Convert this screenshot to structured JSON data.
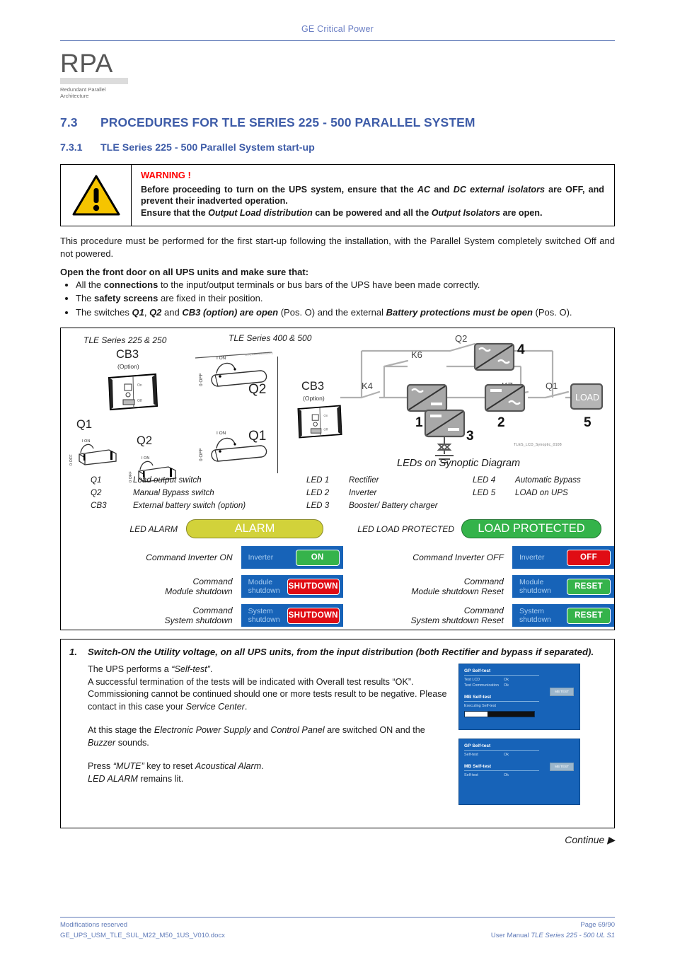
{
  "header": {
    "title": "GE Critical Power"
  },
  "logo": {
    "word": "RPA",
    "line1": "Redundant Parallel",
    "line2": "Architecture"
  },
  "headings": {
    "h1_number": "7.3",
    "h1_text": "PROCEDURES FOR TLE SERIES 225 - 500 PARALLEL SYSTEM",
    "h2_number": "7.3.1",
    "h2_text": "TLE Series 225 - 500 Parallel System start-up"
  },
  "warning": {
    "icon": "warning-triangle-icon",
    "title": "WARNING !",
    "line1_a": "Before proceeding to turn on the UPS system, ensure that the ",
    "line1_i1": "AC",
    "line1_b": " and ",
    "line1_i2": "DC external isolators",
    "line1_c": " are OFF, and prevent their inadverted operation.",
    "line2_a": "Ensure that the ",
    "line2_i1": "Output Load distribution",
    "line2_b": " can be powered and all the ",
    "line2_i2": "Output Isolators",
    "line2_c": " are open."
  },
  "intro": {
    "paragraph": "This procedure must be performed for the first start-up following the installation, with the Parallel System completely switched Off and not powered.",
    "bold_lead": "Open the front door on all UPS units and make sure that:",
    "bullets": [
      {
        "a": "All the ",
        "b1": "connections",
        "c": " to the input/output terminals or bus bars of the UPS have been made correctly."
      },
      {
        "a": "The ",
        "b1": "safety screens",
        "c": " are fixed in their position."
      },
      {
        "a": "The switches ",
        "b1": "Q1",
        "mid1": ", ",
        "b2": "Q2",
        "mid2": " and ",
        "b3": "CB3 (option) are open",
        "mid3": " (Pos. O) and the external ",
        "b4": "Battery protections must be open",
        "c": " (Pos. O)."
      }
    ]
  },
  "diagram": {
    "caption_left": "TLE Series 225 & 250",
    "caption_right": "TLE Series 400 & 500",
    "switches": {
      "cb3": "CB3",
      "cb3_option": "(Option)",
      "q1": "Q1",
      "q2": "Q2",
      "on_label": "I ON",
      "off_label": "0 OFF"
    },
    "synoptic": {
      "caption": "LEDs on Synoptic Diagram",
      "code": "TLES_LCD_Synoptic_0108",
      "nodes": [
        {
          "id": "1",
          "type": "rectifier"
        },
        {
          "id": "2",
          "type": "inverter"
        },
        {
          "id": "3",
          "type": "booster"
        },
        {
          "id": "4",
          "type": "bypass"
        },
        {
          "id": "5",
          "type": "load",
          "label": "LOAD"
        }
      ],
      "contactors": [
        "K4",
        "K6",
        "K7",
        "Q1",
        "Q2"
      ]
    },
    "legend_switches": [
      {
        "key": "Q1",
        "value": "Load output switch"
      },
      {
        "key": "Q2",
        "value": "Manual Bypass switch"
      },
      {
        "key": "CB3",
        "value": "External battery switch (option)"
      }
    ],
    "legend_leds_a": [
      {
        "key": "LED 1",
        "value": "Rectifier"
      },
      {
        "key": "LED 2",
        "value": "Inverter"
      },
      {
        "key": "LED 3",
        "value": "Booster/ Battery charger"
      }
    ],
    "legend_leds_b": [
      {
        "key": "LED 4",
        "value": "Automatic Bypass"
      },
      {
        "key": "LED 5",
        "value": "LOAD on UPS"
      }
    ],
    "led_bars": [
      {
        "label": "LED ALARM",
        "pill": "ALARM",
        "color": "#d2d23a"
      },
      {
        "label": "LED LOAD PROTECTED",
        "pill": "LOAD PROTECTED",
        "color": "#34b34a"
      }
    ],
    "commands": [
      {
        "label": "Command Inverter ON",
        "panel": "Inverter",
        "button": "ON",
        "button_color": "#35b34b"
      },
      {
        "label": "Command Inverter OFF",
        "panel": "Inverter",
        "button": "OFF",
        "button_color": "#e00c14"
      },
      {
        "label_l1": "Command",
        "label_l2": "Module shutdown",
        "panel": "Module shutdown",
        "button": "SHUTDOWN",
        "button_color": "#e00c14"
      },
      {
        "label_l1": "Command",
        "label_l2": "Module shutdown Reset",
        "panel": "Module shutdown",
        "button": "RESET",
        "button_color": "#35b34b"
      },
      {
        "label_l1": "Command",
        "label_l2": "System shutdown",
        "panel": "System shutdown",
        "button": "SHUTDOWN",
        "button_color": "#e00c14"
      },
      {
        "label_l1": "Command",
        "label_l2": "System shutdown Reset",
        "panel": "System shutdown",
        "button": "RESET",
        "button_color": "#35b34b"
      }
    ]
  },
  "step": {
    "number": "1.",
    "title": "Switch-ON the Utility voltage, on all UPS units, from the input distribution (both Rectifier and bypass if separated).",
    "p1_a": "The UPS performs a ",
    "p1_i": "“Self-test”",
    "p1_b": ".",
    "p2": "A successful termination of the tests will be indicated with Overall test results “OK”.",
    "p3_a": "Commissioning cannot be continued should one or more tests result to be negative. Please contact in this case your ",
    "p3_i": "Service Center",
    "p3_b": ".",
    "p4_a": "At this stage the ",
    "p4_i1": "Electronic Power Supply",
    "p4_b": " and ",
    "p4_i2": "Control Panel",
    "p4_c": " are switched ON and the ",
    "p4_i3": "Buzzer",
    "p4_d": " sounds.",
    "p5_a": "Press ",
    "p5_i1": "“MUTE”",
    "p5_b": " key to reset ",
    "p5_i2": "Acoustical Alarm",
    "p5_c": ".",
    "p6_i": "LED ALARM",
    "p6_b": " remains lit.",
    "screens": [
      {
        "gp_title": "GP Self-test",
        "rows": [
          {
            "name": "Test LCD",
            "value": "Ok"
          },
          {
            "name": "Test Communication",
            "value": "Ok"
          }
        ],
        "mb_title": "MB Self-test",
        "mb_status": "Executing Self-test",
        "button": "MB TEST",
        "progress": 33
      },
      {
        "gp_title": "GP Self-test",
        "rows": [
          {
            "name": "Self-test",
            "value": "Ok"
          }
        ],
        "mb_title": "MB Self-test",
        "mb_rows": [
          {
            "name": "Self-test",
            "value": "Ok"
          }
        ],
        "button": "MB TEST"
      }
    ],
    "continue": "Continue"
  },
  "footer": {
    "left_top": "Modifications reserved",
    "left_bottom": "GE_UPS_USM_TLE_SUL_M22_M50_1US_V010.docx",
    "right_top": "Page 69/90",
    "right_bottom_a": "User Manual ",
    "right_bottom_i": "TLE Series 225 - 500 UL S1"
  },
  "colors": {
    "accent": "#3e5ca8",
    "footer": "#5f7ab8",
    "warning_red": "#ff0000"
  }
}
